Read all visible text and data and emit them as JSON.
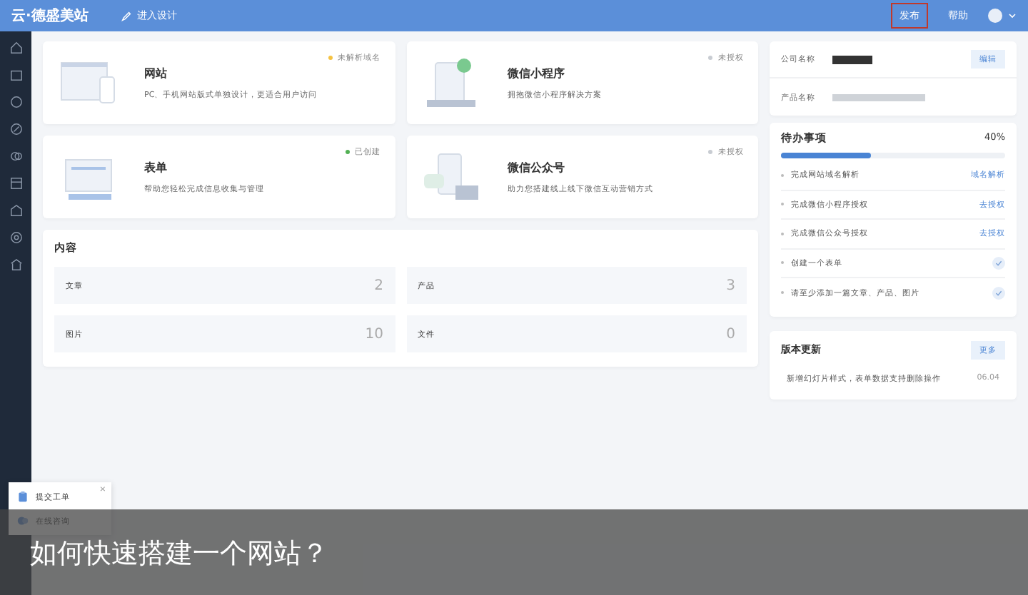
{
  "topbar": {
    "logo": "云·德盛美站",
    "design_link": "进入设计",
    "publish": "发布",
    "help": "帮助"
  },
  "products": [
    {
      "kind": "website",
      "title": "网站",
      "desc": "PC、手机网站版式单独设计，更适合用户访问",
      "status": "未解析域名",
      "color": "#f5c242"
    },
    {
      "kind": "miniprogram",
      "title": "微信小程序",
      "desc": "拥抱微信小程序解决方案",
      "status": "未授权",
      "color": "#c8ccd2"
    },
    {
      "kind": "form",
      "title": "表单",
      "desc": "帮助您轻松完成信息收集与管理",
      "status": "已创建",
      "color": "#52b054"
    },
    {
      "kind": "official",
      "title": "微信公众号",
      "desc": "助力您搭建线上线下微信互动营销方式",
      "status": "未授权",
      "color": "#c8ccd2"
    }
  ],
  "content": {
    "title": "内容",
    "items": [
      {
        "label": "文章",
        "count": "2"
      },
      {
        "label": "产品",
        "count": "3"
      },
      {
        "label": "图片",
        "count": "10"
      },
      {
        "label": "文件",
        "count": "0"
      }
    ]
  },
  "profile": {
    "rows": [
      {
        "label": "公司名称",
        "action": "编辑"
      },
      {
        "label": "产品名称"
      }
    ]
  },
  "todo": {
    "title": "待办事项",
    "percent": "40%",
    "level": 0.4,
    "items": [
      {
        "text": "完成网站域名解析",
        "done": false,
        "action": "域名解析"
      },
      {
        "text": "完成微信小程序授权",
        "done": false,
        "action": "去授权"
      },
      {
        "text": "完成微信公众号授权",
        "done": false,
        "action": "去授权"
      },
      {
        "text": "创建一个表单",
        "done": true
      },
      {
        "text": "请至少添加一篇文章、产品、图片",
        "done": true
      }
    ]
  },
  "updates": {
    "title": "版本更新",
    "more": "更多",
    "items": [
      {
        "text": "新增幻灯片样式，表单数据支持删除操作",
        "date": "06.04"
      }
    ]
  },
  "support": {
    "close": "×",
    "items": [
      "提交工单",
      "在线咨询"
    ]
  },
  "caption": "如何快速搭建一个网站？"
}
